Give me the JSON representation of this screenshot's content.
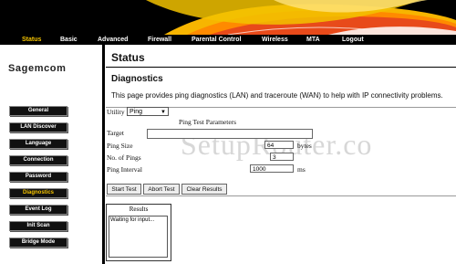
{
  "topnav": {
    "items": [
      {
        "label": "Status",
        "active": true
      },
      {
        "label": "Basic",
        "active": false
      },
      {
        "label": "Advanced",
        "active": false
      },
      {
        "label": "Firewall",
        "active": false
      },
      {
        "label": "Parental Control",
        "active": false
      },
      {
        "label": "Wireless",
        "active": false
      },
      {
        "label": "MTA",
        "active": false
      },
      {
        "label": "Logout",
        "active": false
      }
    ]
  },
  "brand": "Sagemcom",
  "sidebar": {
    "items": [
      {
        "label": "General",
        "active": false
      },
      {
        "label": "LAN Discover",
        "active": false
      },
      {
        "label": "Language",
        "active": false
      },
      {
        "label": "Connection",
        "active": false
      },
      {
        "label": "Password",
        "active": false
      },
      {
        "label": "Diagnostics",
        "active": true
      },
      {
        "label": "Event Log",
        "active": false
      },
      {
        "label": "Init Scan",
        "active": false
      },
      {
        "label": "Bridge Mode",
        "active": false
      }
    ]
  },
  "main": {
    "page_title": "Status",
    "section_heading": "Diagnostics",
    "description": "This page provides ping diagnostics (LAN) and traceroute (WAN) to help with IP connectivity problems.",
    "utility": {
      "label": "Utility",
      "selected": "Ping"
    },
    "ping_params_title": "Ping Test Parameters",
    "fields": {
      "target": {
        "label": "Target",
        "value": ""
      },
      "ping_size": {
        "label": "Ping Size",
        "value": "64",
        "unit": "bytes"
      },
      "no_of_pings": {
        "label": "No. of Pings",
        "value": "3"
      },
      "ping_interval": {
        "label": "Ping Interval",
        "value": "1000",
        "unit": "ms"
      }
    },
    "buttons": {
      "start": "Start Test",
      "abort": "Abort Test",
      "clear": "Clear Results"
    },
    "results": {
      "title": "Results",
      "text": "Waiting for input..."
    }
  },
  "watermark": "SetupRouter.co",
  "colors": {
    "accent": "#f5c400",
    "header_bg": "#000000",
    "sidebar_button": "#111111"
  }
}
